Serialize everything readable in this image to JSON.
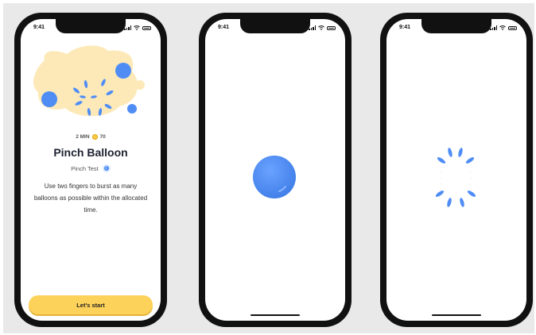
{
  "status_bar": {
    "time": "9:41"
  },
  "screens": [
    {
      "meta": {
        "duration": "2 MIN",
        "points": "70"
      },
      "title": "Pinch Balloon",
      "subtitle": "Pinch Test",
      "description": "Use two fingers to burst as many balloons as possible within the allocated time.",
      "start_button": "Let's start"
    },
    {
      "content": "balloon"
    },
    {
      "content": "burst"
    }
  ],
  "colors": {
    "balloon_blue": "#4f8df5",
    "blob_yellow": "#fde9b8",
    "button_yellow": "#fdd25a",
    "phone_frame": "#111111"
  },
  "icons": [
    "signal-icon",
    "wifi-icon",
    "battery-icon",
    "coin-icon",
    "info-icon",
    "balloon-icon",
    "burst-icon"
  ]
}
